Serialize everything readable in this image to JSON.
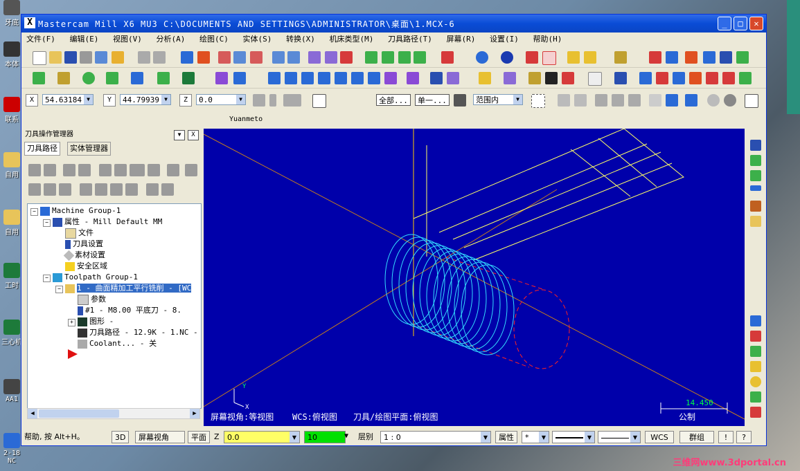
{
  "window": {
    "title": "Mastercam Mill X6 MU3  C:\\DOCUMENTS AND SETTINGS\\ADMINISTRATOR\\桌面\\1.MCX-6",
    "app_icon": "X"
  },
  "menus": [
    "文件(F)",
    "编辑(E)",
    "视图(V)",
    "分析(A)",
    "绘图(C)",
    "实体(S)",
    "转换(X)",
    "机床类型(M)",
    "刀具路径(T)",
    "屏幕(R)",
    "设置(I)",
    "帮助(H)"
  ],
  "coords": {
    "x_label": "X",
    "x_value": "54.63184",
    "y_label": "Y",
    "y_value": "44.79939",
    "z_label": "Z",
    "z_value": "0.0"
  },
  "selection": {
    "all_label": "全部...",
    "single_label": "单一...",
    "range_value": "范围内"
  },
  "window_label": "Yuanmeto",
  "panel": {
    "header": "刀具操作管理器",
    "tabs": [
      "刀具路径",
      "实体管理器"
    ],
    "tree": [
      "Machine Group-1",
      "属性 - Mill Default MM",
      "文件",
      "刀具设置",
      "素材设置",
      "安全区域",
      "Toolpath Group-1",
      "1 - 曲面精加工平行铣削 - [WC",
      "参数",
      "#1 - M8.00 平底刀 -     8.",
      "图形 -",
      "刀具路径 - 12.9K - 1.NC -",
      "Coolant... - 关"
    ]
  },
  "viewport": {
    "screen_view": "屏幕视角:等视图",
    "wcs": "WCS:俯视图",
    "tool_plane": "刀具/绘图平面:俯视图",
    "scale_value": "14.450",
    "scale_unit": "公制",
    "axis_x": "X",
    "axis_y": "Y"
  },
  "status": {
    "help": "帮助, 按 Alt+H。",
    "mode_3d": "3D",
    "screen_view": "屏幕视角",
    "plane": "平面",
    "z_label": "Z",
    "z_value": "0.0",
    "color_value": "10",
    "layer_label": "层别",
    "layer_value": "1 : 0",
    "props": "属性",
    "wcs": "WCS",
    "group": "群组",
    "bang": "!",
    "question": "?"
  },
  "desktop": {
    "icons": [
      "牙底",
      "本体",
      "联系",
      "自用",
      "自用",
      "工时",
      "三心机",
      "AA1",
      "2-18 NC"
    ],
    "watermark": "三维网www.3dportal.cn"
  },
  "colors": {
    "viewport": "#0000aa",
    "titlebar": "#0a4cd6",
    "wireframe": "#ffff66",
    "cylinder": "#33ddff",
    "stock": "#ff2222"
  }
}
